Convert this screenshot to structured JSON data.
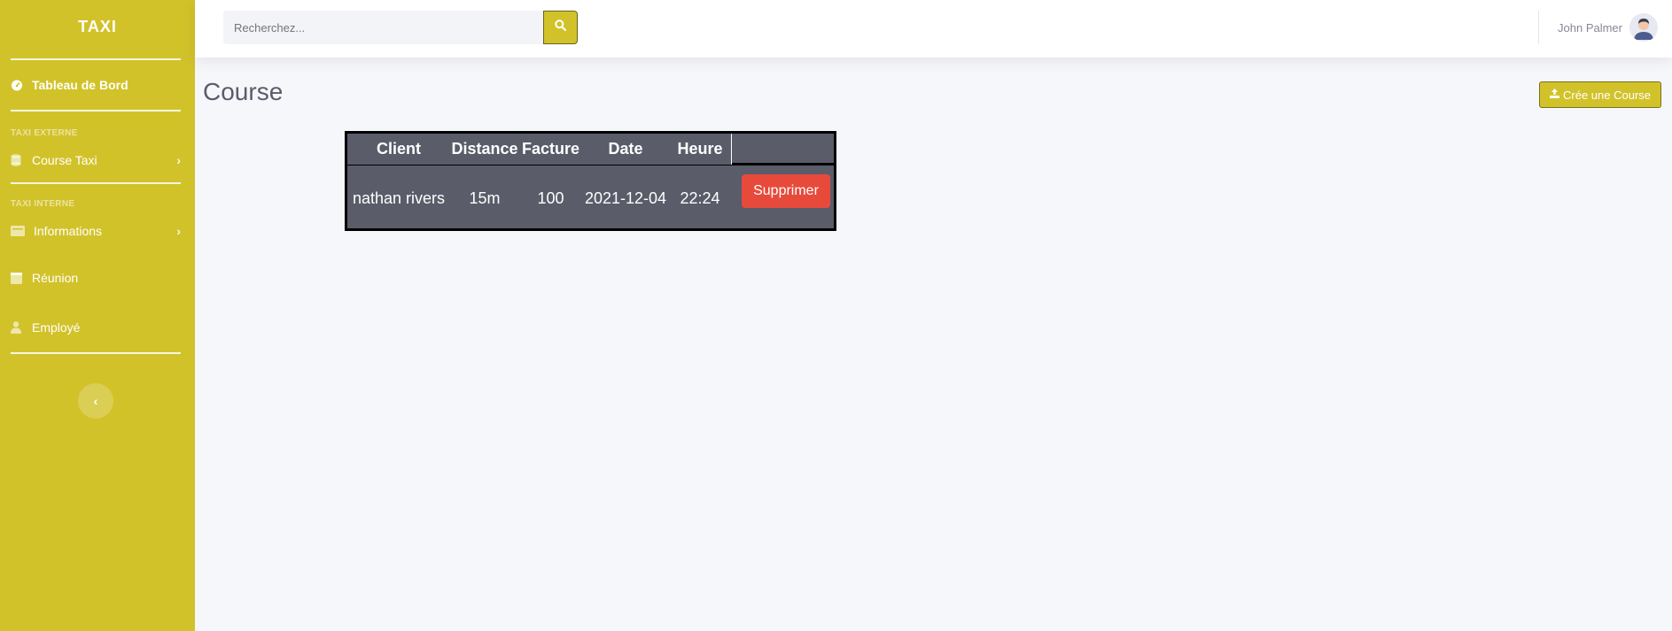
{
  "sidebar": {
    "brand": "TAXI",
    "dashboard_label": "Tableau de Bord",
    "heading_external": "TAXI EXTERNE",
    "course_taxi_label": "Course Taxi",
    "heading_internal": "TAXI INTERNE",
    "informations_label": "Informations",
    "reunion_label": "Réunion",
    "employe_label": "Employé"
  },
  "topbar": {
    "search_placeholder": "Recherchez...",
    "user_name": "John Palmer"
  },
  "page": {
    "title": "Course",
    "create_button": "Crée une Course"
  },
  "table": {
    "headers": [
      "Client",
      "Distance",
      "Facture",
      "Date",
      "Heure"
    ],
    "rows": [
      {
        "client": "nathan rivers",
        "distance": "15m",
        "facture": "100",
        "date": "2021-12-04",
        "heure": "22:24",
        "action": "Supprimer"
      }
    ]
  },
  "colors": {
    "accent": "#d2c22a",
    "danger": "#e74a3b",
    "table_bg": "#5a5c69"
  }
}
